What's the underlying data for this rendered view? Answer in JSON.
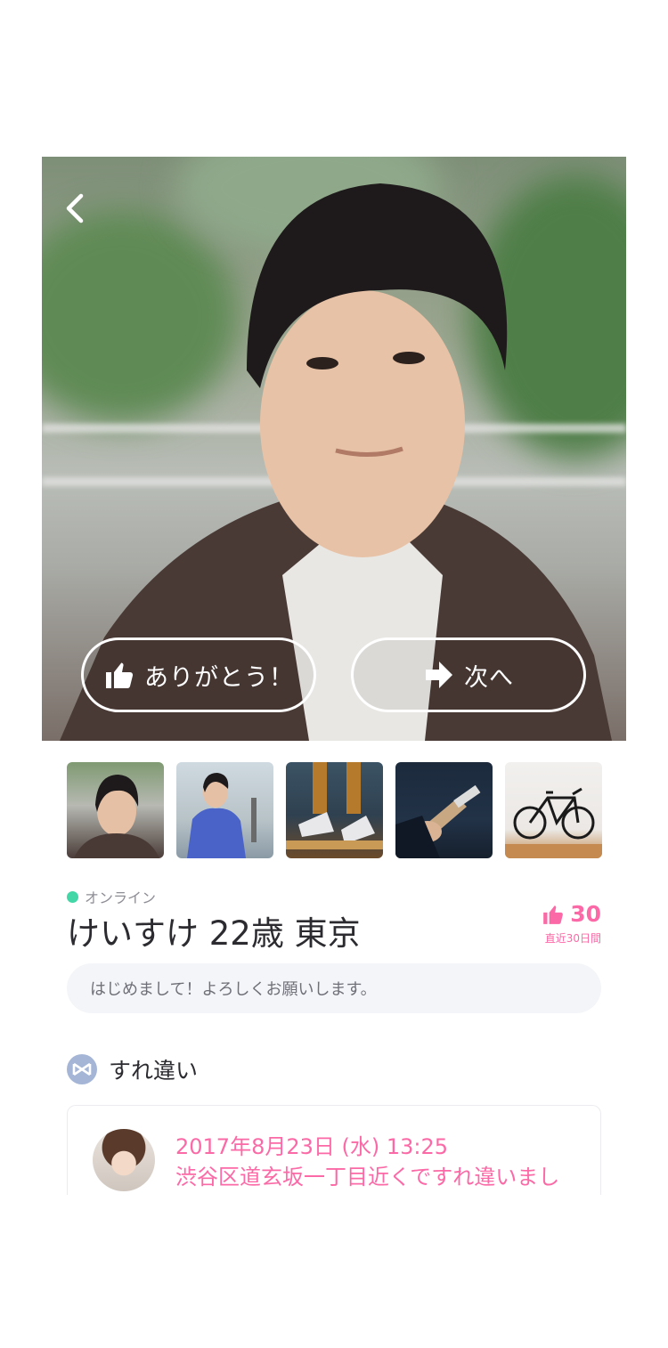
{
  "colors": {
    "accent_pink": "#fb6aa6",
    "online_green": "#43d6a6",
    "section_icon_blue": "#a4b5d6",
    "text_dark": "#2b2b30",
    "bio_background": "#f4f5f8"
  },
  "hero": {
    "back_icon": "chevron-left-icon",
    "thanks_label": "ありがとう！",
    "thanks_icon": "thumbs-up-icon",
    "next_label": "次へ",
    "next_icon": "arrow-right-icon"
  },
  "thumbnails": [
    {
      "subject": "portrait"
    },
    {
      "subject": "man in blue hoodie"
    },
    {
      "subject": "sneakers on skateboard"
    },
    {
      "subject": "guitar"
    },
    {
      "subject": "bicycle"
    }
  ],
  "profile": {
    "status": "オンライン",
    "name_line": "けいすけ 22歳 東京",
    "likes_count": "30",
    "likes_period": "直近30日間",
    "bio": "はじめまして！よろしくお願いします。"
  },
  "encounter": {
    "section_title": "すれ違い",
    "date": "2017年8月23日 (水) 13:25",
    "message": "渋谷区道玄坂一丁目近くですれ違いまし"
  }
}
